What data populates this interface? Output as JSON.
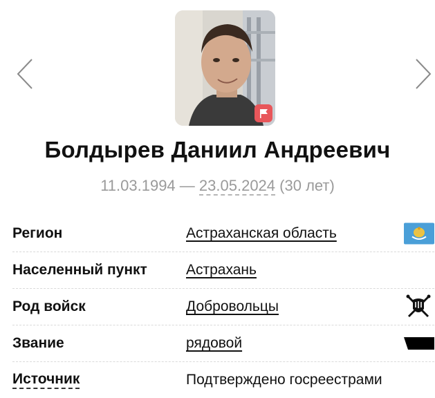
{
  "person": {
    "full_name": "Болдырев Даниил Андреевич",
    "birth_date": "11.03.1994",
    "dash": "—",
    "death_date": "23.05.2024",
    "age": "(30 лет)"
  },
  "info": {
    "region": {
      "label": "Регион",
      "value": "Астраханская область",
      "icon": "region-emblem-icon"
    },
    "settlement": {
      "label": "Населенный пункт",
      "value": "Астрахань"
    },
    "branch": {
      "label": "Род войск",
      "value": "Добровольцы",
      "icon": "volunteers-emblem-icon"
    },
    "rank": {
      "label": "Звание",
      "value": "рядовой",
      "icon": "rank-insignia-icon"
    },
    "source": {
      "label": "Источник",
      "value": "Подтверждено госреестрами"
    }
  },
  "colors": {
    "badge": "#e8565a",
    "muted_text": "#9a9a9a",
    "region_flag": "#4a9fd8"
  }
}
